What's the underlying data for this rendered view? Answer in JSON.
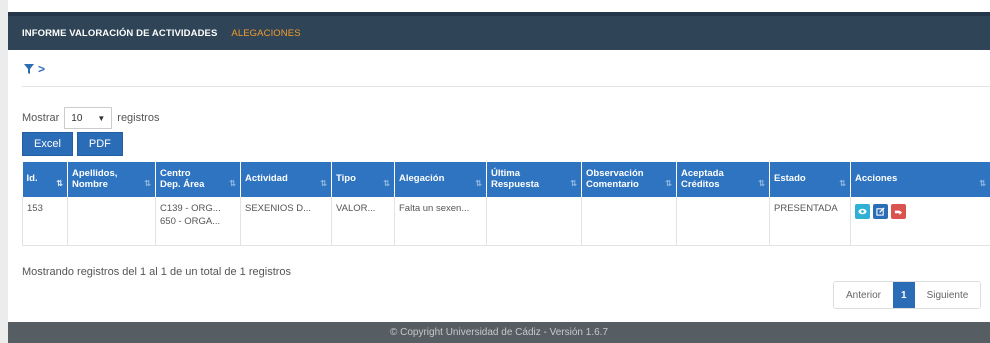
{
  "nav": {
    "items": [
      {
        "label": "INFORME VALORACIÓN DE ACTIVIDADES"
      },
      {
        "label": "ALEGACIONES"
      }
    ]
  },
  "filter": {
    "icon": "filter-icon",
    "chevron": ">"
  },
  "length": {
    "prefix": "Mostrar",
    "value": "10",
    "suffix": "registros"
  },
  "buttons": {
    "excel": "Excel",
    "pdf": "PDF"
  },
  "table": {
    "headers": [
      {
        "line1": "Id.",
        "line2": ""
      },
      {
        "line1": "Apellidos,",
        "line2": "Nombre"
      },
      {
        "line1": "Centro",
        "line2": "Dep. Área"
      },
      {
        "line1": "Actividad",
        "line2": ""
      },
      {
        "line1": "Tipo",
        "line2": ""
      },
      {
        "line1": "Alegación",
        "line2": ""
      },
      {
        "line1": "Última",
        "line2": "Respuesta"
      },
      {
        "line1": "Observación",
        "line2": "Comentario"
      },
      {
        "line1": "Aceptada",
        "line2": "Créditos"
      },
      {
        "line1": "Estado",
        "line2": ""
      },
      {
        "line1": "Acciones",
        "line2": ""
      }
    ],
    "rows": [
      {
        "id": "153",
        "nombre": "",
        "centro1": "C139 - ORG...",
        "centro2": "650 - ORGA...",
        "actividad": "SEXENIOS D...",
        "tipo": "VALOR...",
        "alegacion": "Falta un sexen...",
        "respuesta": "",
        "observacion": "",
        "creditos": "",
        "estado": "PRESENTADA"
      }
    ]
  },
  "info": "Mostrando registros del 1 al 1 de un total de 1 registros",
  "pager": {
    "prev": "Anterior",
    "current": "1",
    "next": "Siguiente"
  },
  "footer": "© Copyright Universidad de Cádiz - Versión 1.6.7",
  "colors": {
    "topbar": "#2f4456",
    "accent": "#f39c2c",
    "header": "#2f74c0",
    "button": "#2b6cb7",
    "danger": "#d9534f",
    "info": "#31b0d5"
  }
}
